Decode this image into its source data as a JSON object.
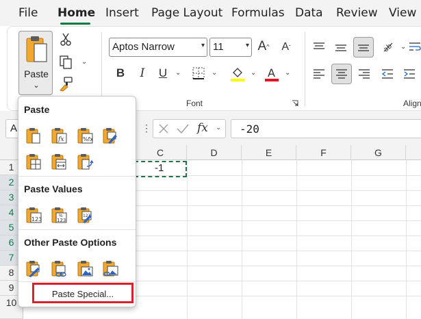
{
  "tabs": [
    {
      "label": "File"
    },
    {
      "label": "Home"
    },
    {
      "label": "Insert"
    },
    {
      "label": "Page Layout"
    },
    {
      "label": "Formulas"
    },
    {
      "label": "Data"
    },
    {
      "label": "Review"
    },
    {
      "label": "View"
    }
  ],
  "active_tab": "Home",
  "clipboard": {
    "paste_label": "Paste"
  },
  "font": {
    "font_name": "Aptos Narrow",
    "font_size": "11",
    "group_label": "Font",
    "bold": "B",
    "italic": "I",
    "underline": "U"
  },
  "alignment": {
    "group_label": "Align"
  },
  "formula_bar": {
    "name_box": "A",
    "fx": "fx",
    "formula": "-20"
  },
  "grid": {
    "columns": [
      "C",
      "D",
      "E",
      "F",
      "G"
    ],
    "rows": [
      "1",
      "2",
      "3",
      "4",
      "5",
      "6",
      "7",
      "8",
      "9",
      "10"
    ],
    "cell_C1": "-1"
  },
  "paste_menu": {
    "section_paste": "Paste",
    "section_paste_values": "Paste Values",
    "section_other": "Other Paste Options",
    "paste_special": "Paste Special..."
  },
  "colors": {
    "accent": "#107c41",
    "highlight_bar": "#ffff00",
    "font_color_bar": "#e81123",
    "paste_special_border": "#d9202c"
  }
}
